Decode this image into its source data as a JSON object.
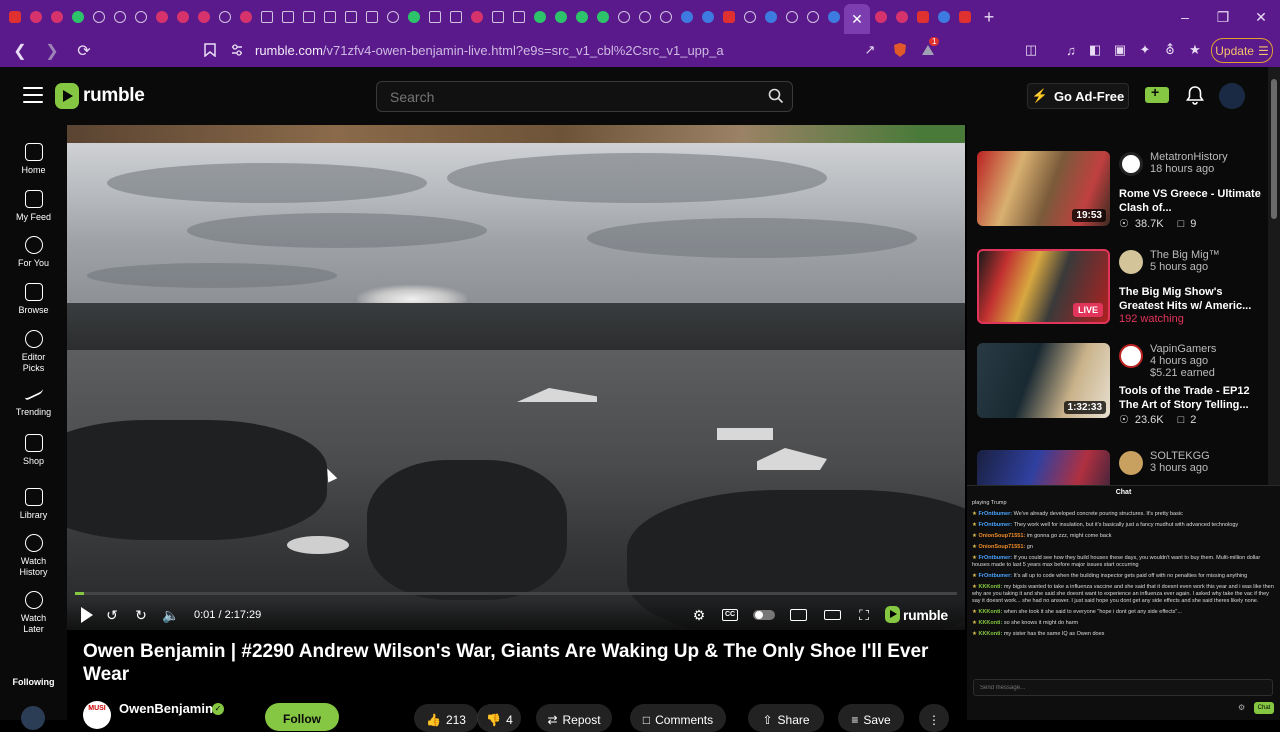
{
  "browser": {
    "url_host": "rumble.com",
    "url_path": "/v71zfv4-owen-benjamin-live.html?e9s=src_v1_cbl%2Csrc_v1_upp_a",
    "update_label": "Update",
    "shield_count": "1"
  },
  "header": {
    "logo": "rumble",
    "search_placeholder": "Search",
    "adfree_label": "Go Ad-Free"
  },
  "nav": {
    "items": [
      {
        "label": "Home"
      },
      {
        "label": "My Feed"
      },
      {
        "label": "For You"
      },
      {
        "label": "Browse"
      },
      {
        "label": "Editor Picks"
      },
      {
        "label": "Trending"
      },
      {
        "label": "Shop"
      },
      {
        "label": "Library"
      },
      {
        "label": "Watch History"
      },
      {
        "label": "Watch Later"
      }
    ],
    "following_label": "Following"
  },
  "player": {
    "time": "0:01 / 2:17:29",
    "logo": "rumble",
    "progress": 0.001
  },
  "video": {
    "title": "Owen Benjamin | #2290 Andrew Wilson's War, Giants Are Waking Up & The Only Shoe I'll Ever Wear",
    "channel": "OwenBenjamin",
    "follow_label": "Follow",
    "likes": "213",
    "dislikes": "4",
    "repost_label": "Repost",
    "comments_label": "Comments",
    "share_label": "Share",
    "save_label": "Save"
  },
  "recommendations": [
    {
      "channel": "MetatronHistory",
      "ago": "18 hours ago",
      "title": "Rome VS Greece - Ultimate Clash of...",
      "duration": "19:53",
      "views": "38.7K",
      "comments": "9"
    },
    {
      "channel": "The Big Mig™",
      "ago": "5 hours ago",
      "title": "The Big Mig Show's Greatest Hits w/ Americ...",
      "live": "LIVE",
      "watching": "192 watching"
    },
    {
      "channel": "VapinGamers",
      "ago": "4 hours ago",
      "earned": "$5.21 earned",
      "title": "Tools of the Trade - EP12 The Art of Story Telling...",
      "duration": "1:32:33",
      "views": "23.6K",
      "comments": "2"
    },
    {
      "channel": "SOLTEKGG",
      "ago": "3 hours ago"
    }
  ],
  "chat": {
    "title": "Chat",
    "input_placeholder": "Send message...",
    "send_label": "Chat",
    "messages": [
      {
        "user": "",
        "text": "playing Trump"
      },
      {
        "user": "FrOntbumer:",
        "text": "We've already developed concrete pouring structures. It's pretty basic"
      },
      {
        "user": "FrOntbumer:",
        "text": "They work well for insulation, but it's basically just a fancy mudhut with advanced technology"
      },
      {
        "user": "OnionSoup71551:",
        "text": "im gonna go zzz, might come back"
      },
      {
        "user": "OnionSoup71551:",
        "text": "gn"
      },
      {
        "user": "FrOntbumer:",
        "text": "If you could see how they build houses these days, you wouldn't want to buy them. Multi-million dollar houses made to last 5 years max before major issues start occurring"
      },
      {
        "user": "FrOntbumer:",
        "text": "It's all up to code when the building inspector gets paid off with no penalties for missing anything"
      },
      {
        "user": "KKKonti:",
        "text": "my bigsis wanted to take a influenza vaccine and she said that it doesnt even work this year and i was like then why are you taking it and she said she doesnt want to experience an influenza ever again. I asked why take the vac if they say it doesnt work... she had no answer. I just said hope you dont get any side effects and she said theres likely none."
      },
      {
        "user": "KKKonti:",
        "text": "when she took it she said to everyone \"hope i dont get any side effects\"..."
      },
      {
        "user": "KKKonti:",
        "text": "so she knows it might do harm"
      },
      {
        "user": "KKKonti:",
        "text": "my sister has the same IQ as Owen does"
      }
    ]
  },
  "colors": {
    "accent": "#85c742",
    "browser": "#5b1a8c",
    "live": "#e2355b"
  }
}
